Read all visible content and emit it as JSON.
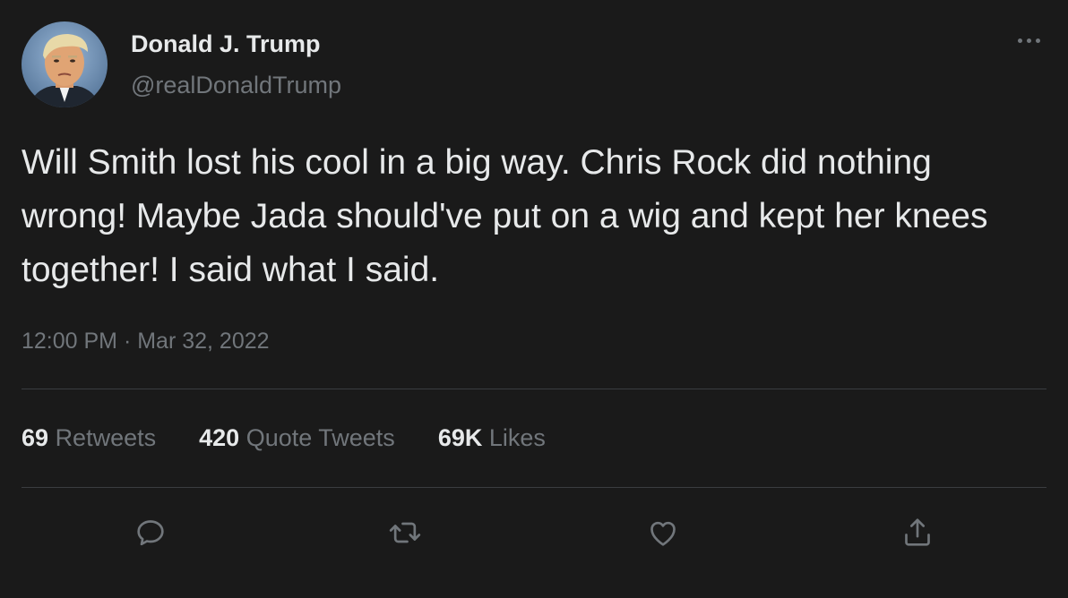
{
  "user": {
    "display_name": "Donald J. Trump",
    "handle": "@realDonaldTrump"
  },
  "tweet": {
    "text": "Will Smith lost his cool in a big way. Chris Rock did nothing wrong! Maybe Jada should've put on a wig and kept her knees together! I said what I said.",
    "timestamp": "12:00 PM · Mar 32, 2022"
  },
  "stats": {
    "retweets": {
      "count": "69",
      "label": "Retweets"
    },
    "quotes": {
      "count": "420",
      "label": "Quote Tweets"
    },
    "likes": {
      "count": "69K",
      "label": "Likes"
    }
  },
  "icons": {
    "more": "more-horizontal-icon",
    "reply": "reply-icon",
    "retweet": "retweet-icon",
    "like": "heart-icon",
    "share": "share-icon"
  },
  "colors": {
    "background": "#1a1a1a",
    "primary_text": "#e7e9ea",
    "secondary_text": "#71767b",
    "divider": "#3a3d40"
  }
}
